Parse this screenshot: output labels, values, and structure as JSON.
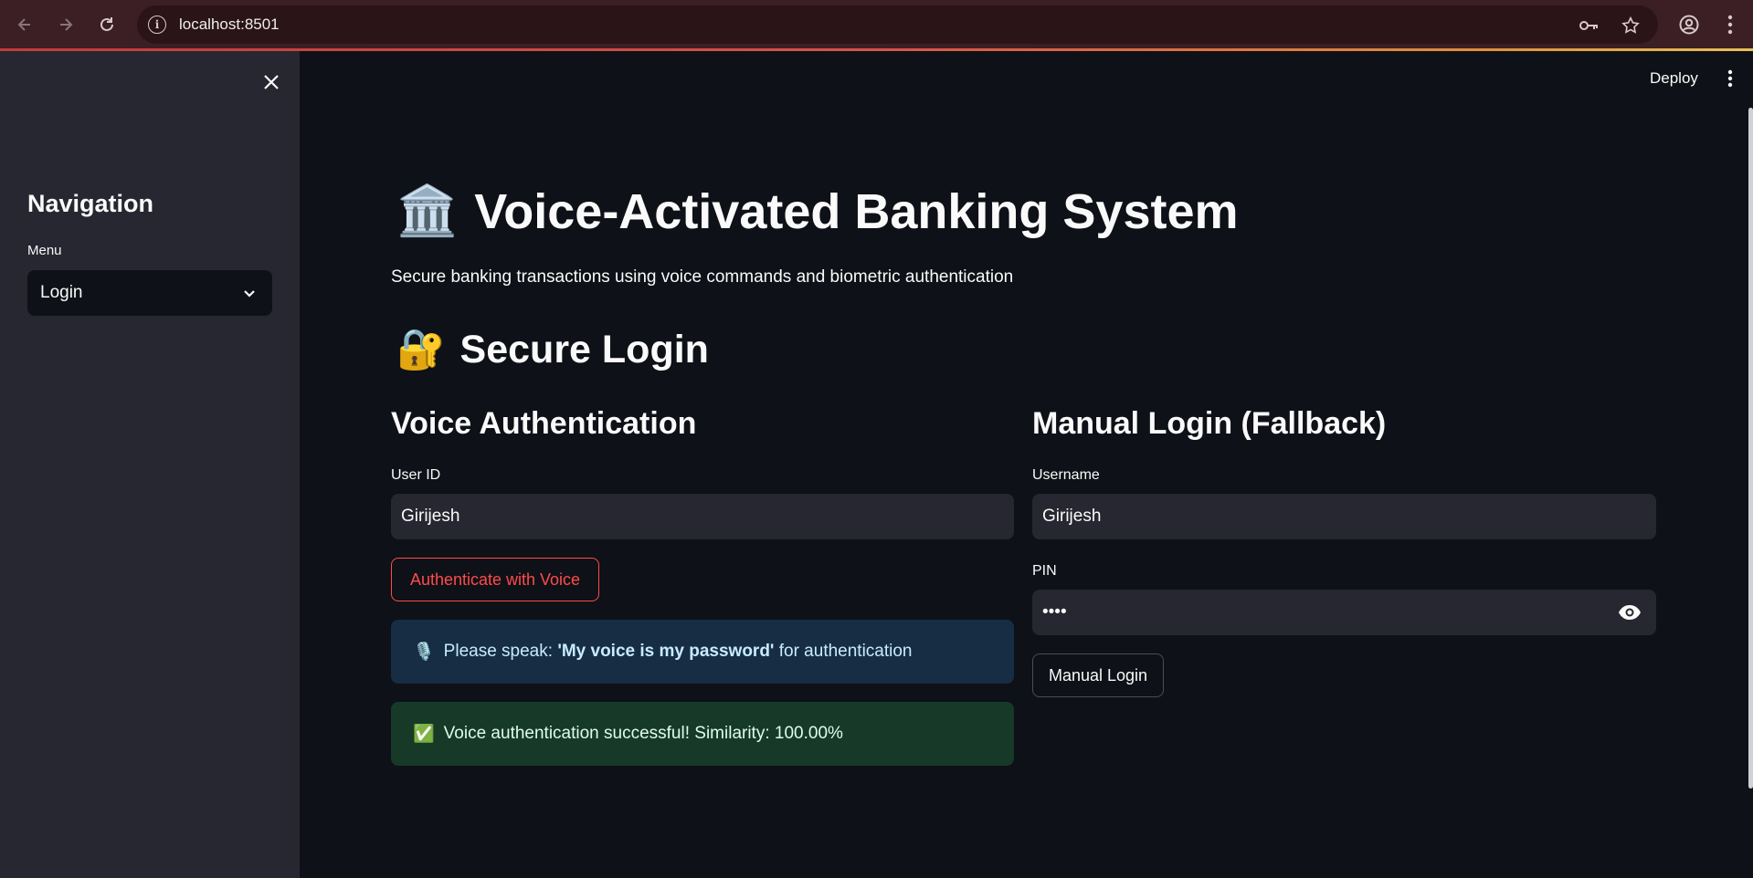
{
  "browser": {
    "url": "localhost:8501"
  },
  "sidebar": {
    "heading": "Navigation",
    "menu_label": "Menu",
    "menu_selected": "Login"
  },
  "header": {
    "deploy_label": "Deploy"
  },
  "main": {
    "title_emoji": "🏛️",
    "title": "Voice-Activated Banking System",
    "subtitle": "Secure banking transactions using voice commands and biometric authentication",
    "section_emoji": "🔐",
    "section_title": "Secure Login",
    "voice": {
      "heading": "Voice Authentication",
      "user_id_label": "User ID",
      "user_id_value": "Girijesh",
      "button_label": "Authenticate with Voice",
      "info_emoji": "🎙️",
      "info_prefix": "Please speak: ",
      "info_phrase": "'My voice is my password'",
      "info_suffix": " for authentication",
      "success_emoji": "✅",
      "success_text": "Voice authentication successful! Similarity: 100.00%"
    },
    "manual": {
      "heading": "Manual Login (Fallback)",
      "username_label": "Username",
      "username_value": "Girijesh",
      "pin_label": "PIN",
      "pin_value": "••••",
      "button_label": "Manual Login"
    }
  }
}
